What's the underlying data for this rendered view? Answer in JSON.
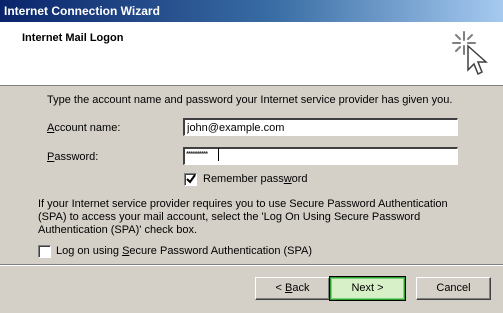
{
  "window": {
    "title": "Internet Connection Wizard"
  },
  "header": {
    "heading": "Internet Mail Logon",
    "icon": "wizard-wand-cursor"
  },
  "form": {
    "intro": "Type the account name and password your Internet service provider has given you.",
    "account_label_u": "A",
    "account_label_rest": "ccount name:",
    "account_value": "john@example.com",
    "password_label_u": "P",
    "password_label_rest": "assword:",
    "password_mask": "**********",
    "remember_label_u": "w",
    "remember_label_pre": "Remember pass",
    "remember_label_post": "ord",
    "remember_checked": true,
    "spa_text": "If your Internet service provider requires you to use Secure Password Authentication (SPA) to access your mail account, select the 'Log On Using Secure Password Authentication (SPA)' check box.",
    "spa_label_pre": "Log on using ",
    "spa_label_u": "S",
    "spa_label_post": "ecure Password Authentication (SPA)",
    "spa_checked": false
  },
  "buttons": {
    "back_prefix": "< ",
    "back_u": "B",
    "back_rest": "ack",
    "next_label": "Next >",
    "cancel_label": "Cancel"
  }
}
